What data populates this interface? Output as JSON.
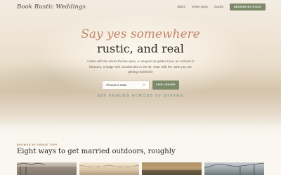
{
  "site": {
    "logo": "Book Rustic Weddings"
  },
  "nav": {
    "links": [
      "States",
      "Venue types",
      "Guides"
    ],
    "cta": "BROWSE BY STATE"
  },
  "hero": {
    "tagline_script": "Say yes somewhere",
    "tagline_serif": "rustic, and real",
    "description": "A barn with the doors thrown open, a vineyard at golden hour, an orchard in blossom, a lodge with woodsmoke in the air. Start with the state you are getting married in",
    "select_value": "Choose a state",
    "find_button": "FIND VENUES",
    "venue_count": "829 VENUES ACROSS 50 STATES"
  },
  "section": {
    "eyebrow": "BROWSE BY VENUE TYPE",
    "title": "Eight ways to get married outdoors, roughly"
  },
  "colors": {
    "accent_green": "#7d8a6a",
    "script_terracotta": "#c4866a",
    "count_teal": "#8a9f9a",
    "eyebrow_rust": "#b07b5f"
  },
  "icons": {
    "select_chevron": "chevron-down-icon"
  }
}
